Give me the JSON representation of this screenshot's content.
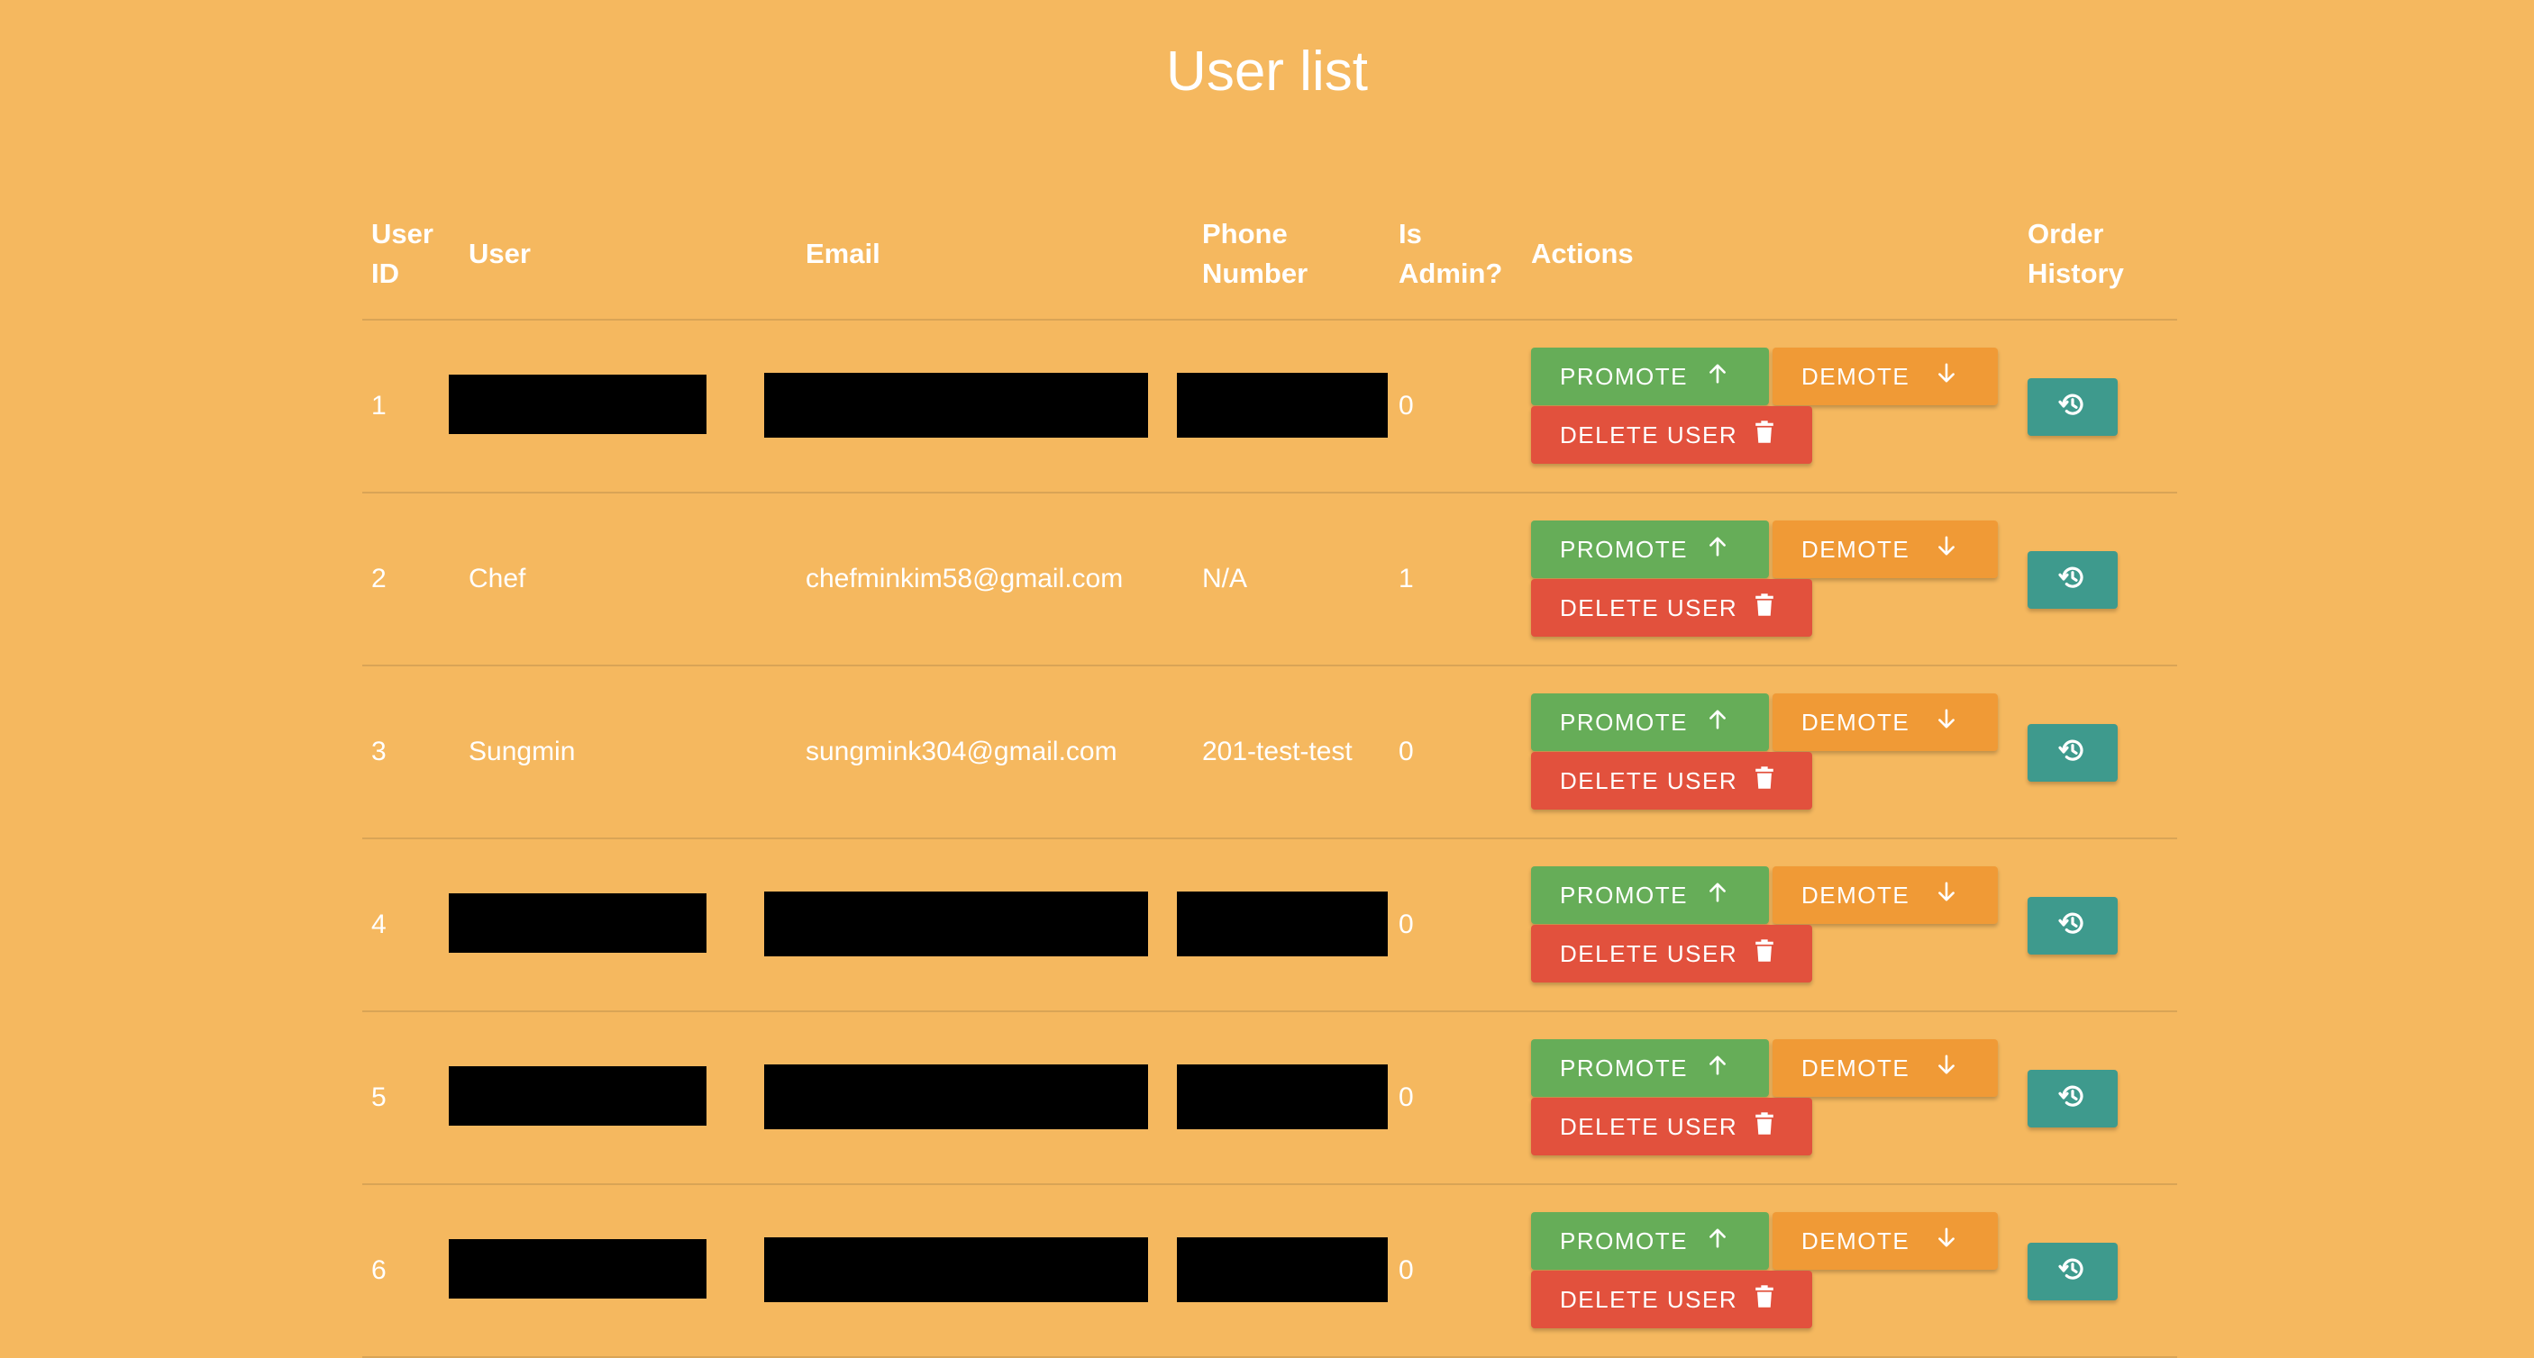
{
  "page": {
    "title": "User list"
  },
  "colors": {
    "background": "#f5b85f",
    "promote": "#66ad58",
    "demote": "#f09a36",
    "delete": "#e2513d",
    "history": "#3e9a8d"
  },
  "table": {
    "headers": {
      "user_id": [
        "User",
        "ID"
      ],
      "user": "User",
      "email": "Email",
      "phone": [
        "Phone",
        "Number"
      ],
      "is_admin": [
        "Is",
        "Admin?"
      ],
      "actions": "Actions",
      "order_history": [
        "Order",
        "History"
      ]
    },
    "actions": {
      "promote_label": "PROMOTE",
      "demote_label": "DEMOTE",
      "delete_label": "DELETE USER",
      "promote_icon": "arrow-up-icon",
      "demote_icon": "arrow-down-icon",
      "delete_icon": "trash-icon",
      "history_icon": "history-icon"
    },
    "rows": [
      {
        "id": "1",
        "user": null,
        "email": null,
        "phone": null,
        "is_admin": "0",
        "redacted": true
      },
      {
        "id": "2",
        "user": "Chef",
        "email": "chefminkim58@gmail.com",
        "phone": "N/A",
        "is_admin": "1",
        "redacted": false
      },
      {
        "id": "3",
        "user": "Sungmin",
        "email": "sungmink304@gmail.com",
        "phone": "201-test-test",
        "is_admin": "0",
        "redacted": false
      },
      {
        "id": "4",
        "user": null,
        "email": null,
        "phone": null,
        "is_admin": "0",
        "redacted": true
      },
      {
        "id": "5",
        "user": null,
        "email": null,
        "phone": null,
        "is_admin": "0",
        "redacted": true
      },
      {
        "id": "6",
        "user": null,
        "email": null,
        "phone": null,
        "is_admin": "0",
        "redacted": true
      }
    ]
  }
}
